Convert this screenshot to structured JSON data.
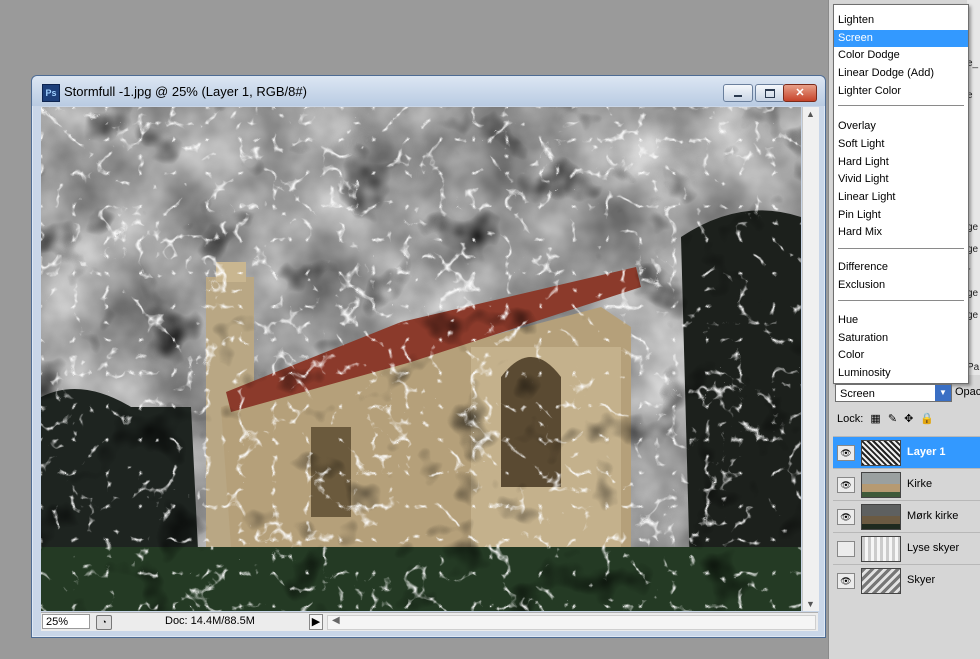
{
  "document": {
    "app_icon_label": "Ps",
    "title": "Stormfull -1.jpg @ 25% (Layer 1, RGB/8#)",
    "zoom": "25%",
    "doc_size": "Doc: 14.4M/88.5M"
  },
  "blend_modes": {
    "items": [
      {
        "label": "Lighten",
        "selected": false
      },
      {
        "label": "Screen",
        "selected": true
      },
      {
        "label": "Color Dodge",
        "selected": false
      },
      {
        "label": "Linear Dodge (Add)",
        "selected": false
      },
      {
        "label": "Lighter Color",
        "selected": false
      },
      {
        "label": "Overlay",
        "selected": false
      },
      {
        "label": "Soft Light",
        "selected": false
      },
      {
        "label": "Hard Light",
        "selected": false
      },
      {
        "label": "Vivid Light",
        "selected": false
      },
      {
        "label": "Linear Light",
        "selected": false
      },
      {
        "label": "Pin Light",
        "selected": false
      },
      {
        "label": "Hard Mix",
        "selected": false
      },
      {
        "label": "Difference",
        "selected": false
      },
      {
        "label": "Exclusion",
        "selected": false
      },
      {
        "label": "Hue",
        "selected": false
      },
      {
        "label": "Saturation",
        "selected": false
      },
      {
        "label": "Color",
        "selected": false
      },
      {
        "label": "Luminosity",
        "selected": false
      }
    ],
    "current": "Screen",
    "opacity_label": "Opac"
  },
  "side_strip": [
    "e_",
    "e",
    "i",
    "ge",
    "ge",
    "r",
    "ge",
    "ge",
    "Pa"
  ],
  "lock_label": "Lock:",
  "layers": [
    {
      "name": "Layer 1",
      "visible": true,
      "selected": true
    },
    {
      "name": "Kirke",
      "visible": true,
      "selected": false
    },
    {
      "name": "Mørk kirke",
      "visible": true,
      "selected": false
    },
    {
      "name": "Lyse skyer",
      "visible": false,
      "selected": false
    },
    {
      "name": "Skyer",
      "visible": true,
      "selected": false
    }
  ],
  "colors": {
    "selection": "#3399ff",
    "panel": "#d6d6d6",
    "workspace": "#9a9a9a",
    "roof": "#8b3a2b"
  }
}
